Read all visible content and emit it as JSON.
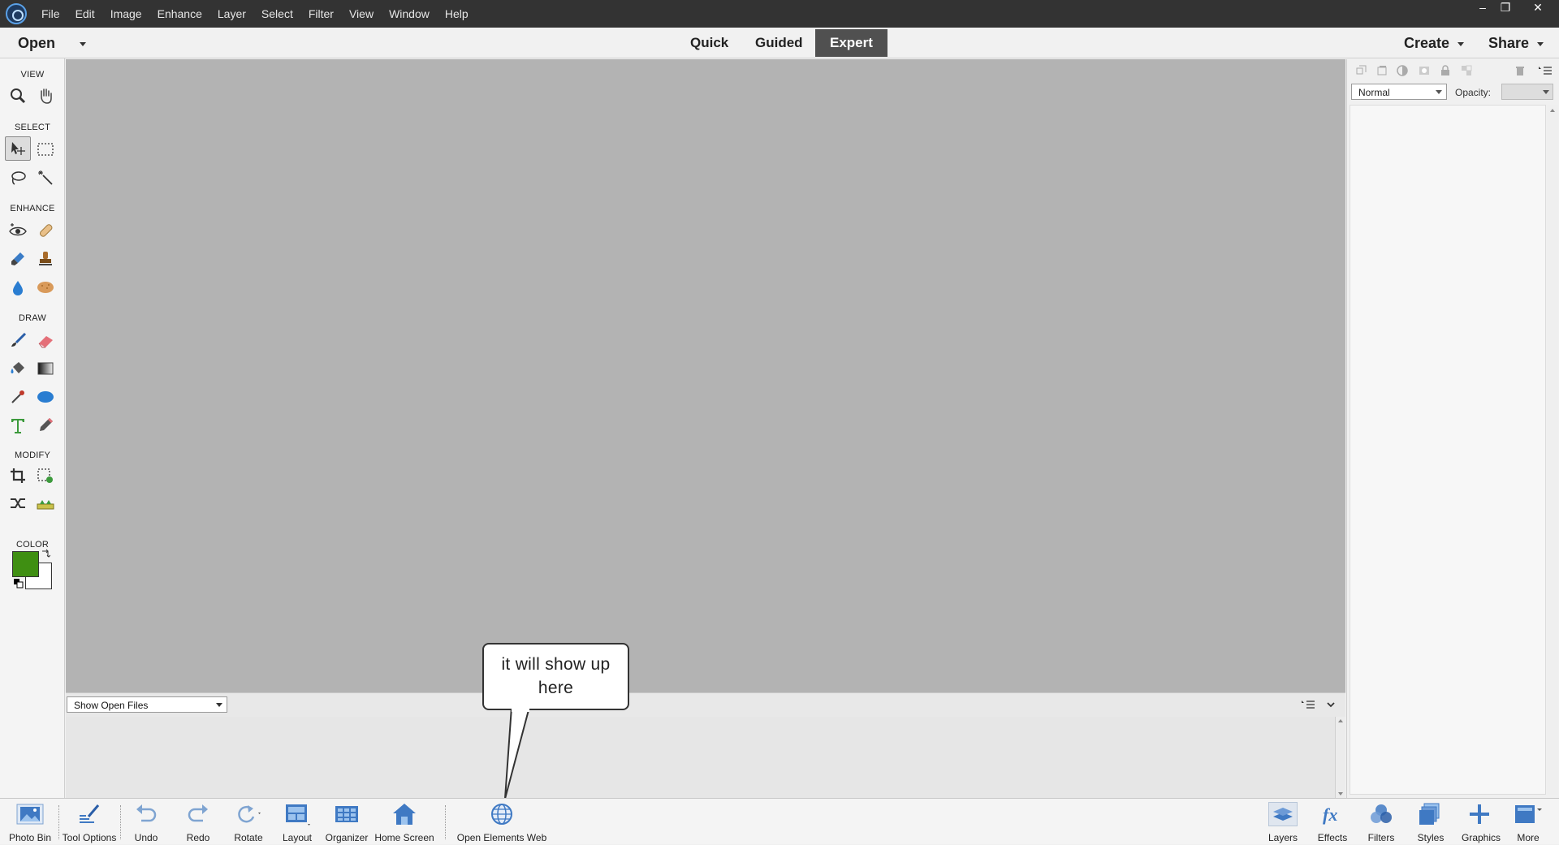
{
  "menubar": {
    "items": [
      "File",
      "Edit",
      "Image",
      "Enhance",
      "Layer",
      "Select",
      "Filter",
      "View",
      "Window",
      "Help"
    ],
    "window_controls": {
      "minimize": "‒",
      "restore": "❐",
      "close": "✕"
    }
  },
  "topbar": {
    "open_label": "Open",
    "modes": [
      "Quick",
      "Guided",
      "Expert"
    ],
    "active_mode": "Expert",
    "create_label": "Create",
    "share_label": "Share"
  },
  "toolbox": {
    "groups": [
      "VIEW",
      "SELECT",
      "ENHANCE",
      "DRAW",
      "MODIFY",
      "COLOR"
    ],
    "foreground_color": "#3f8f12",
    "background_color": "#ffffff"
  },
  "layers_panel": {
    "blend_mode": "Normal",
    "opacity_label": "Opacity:"
  },
  "bin": {
    "select_value": "Show Open Files"
  },
  "callout": {
    "text": "it will show up here"
  },
  "bottombar": {
    "left": [
      {
        "label": "Photo Bin",
        "icon": "photo-bin-icon"
      },
      {
        "label": "Tool Options",
        "icon": "tool-options-icon"
      },
      {
        "label": "Undo",
        "icon": "undo-icon"
      },
      {
        "label": "Redo",
        "icon": "redo-icon"
      },
      {
        "label": "Rotate",
        "icon": "rotate-icon"
      },
      {
        "label": "Layout",
        "icon": "layout-icon"
      },
      {
        "label": "Organizer",
        "icon": "organizer-icon"
      },
      {
        "label": "Home Screen",
        "icon": "home-icon"
      },
      {
        "label": "Open Elements Web",
        "icon": "globe-icon"
      }
    ],
    "right": [
      {
        "label": "Layers",
        "icon": "layers-icon"
      },
      {
        "label": "Effects",
        "icon": "effects-icon"
      },
      {
        "label": "Filters",
        "icon": "filters-icon"
      },
      {
        "label": "Styles",
        "icon": "styles-icon"
      },
      {
        "label": "Graphics",
        "icon": "graphics-icon"
      },
      {
        "label": "More",
        "icon": "more-icon"
      }
    ]
  }
}
